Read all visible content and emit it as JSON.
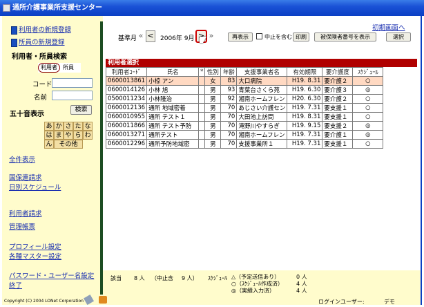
{
  "window": {
    "title": "通所介護事業所支援センター"
  },
  "top_link": "初期画面へ",
  "sidebar": {
    "new_user_reg": "利用者の新規登録",
    "new_staff_reg": "所員の新規登録",
    "search_heading": "利用者・所員検索",
    "radio_user": "利用者",
    "radio_staff": "所員",
    "code_label": "コード",
    "name_label": "名前",
    "gojuon_label": "五十音表示",
    "search_button": "検索",
    "kana_row1": [
      "あ",
      "か",
      "さ",
      "た",
      "な"
    ],
    "kana_row2": [
      "は",
      "ま",
      "や",
      "ら",
      "わ"
    ],
    "kana_row3_first": "ん",
    "kana_other": "その他",
    "links": [
      "全件表示",
      "国保連請求",
      "日別スケジュール",
      "利用者請求",
      "管理帳票",
      "プロフィール設定",
      "各種マスター設定",
      "パスワード・ユーザー名設定",
      "終了"
    ]
  },
  "toolbar": {
    "month_label": "基準月",
    "prev_prev": "«",
    "prev": "<",
    "month_value": "2006年 9月",
    "next": ">",
    "next_next": "»",
    "display_btn": "再表示",
    "include_suspended": "中止を含む",
    "print_btn": "印刷",
    "insured_no_btn": "被保険者番号を表示",
    "select_btn": "選択"
  },
  "section_title": "利用者選択",
  "table": {
    "headers": [
      "利用者ｺｰﾄﾞ",
      "氏名",
      "*",
      "性別",
      "年齢",
      "支援事業者名",
      "有効期限",
      "要介護度",
      "ｽｹｼﾞｭｰﾙ"
    ],
    "rows": [
      [
        "0600013861",
        "小椋 アン",
        "",
        "女",
        "83",
        "大口病院",
        "H19. 8.31",
        "要介護２",
        "○"
      ],
      [
        "0600014126",
        "小林 旭",
        "",
        "男",
        "93",
        "青葉台さくら苑",
        "H19. 6.30",
        "要介護３",
        "◎"
      ],
      [
        "0500011234",
        "小林隆治",
        "",
        "男",
        "92",
        "湘南ホームフレン",
        "H20. 6.30",
        "要介護２",
        "○"
      ],
      [
        "0600012136",
        "通所 地域密着",
        "",
        "男",
        "70",
        "あじさい介護セン",
        "H19. 7.31",
        "要支援１",
        "○"
      ],
      [
        "0600010955",
        "通所 テスト１",
        "",
        "男",
        "70",
        "大田池上訪問",
        "H19. 8.31",
        "要支援１",
        "○"
      ],
      [
        "0600011866",
        "通所 テスト予防",
        "",
        "男",
        "70",
        "滝野川やすらぎ",
        "H19. 9.15",
        "要支援２",
        "◎"
      ],
      [
        "0600013271",
        "通所テスト",
        "",
        "男",
        "70",
        "湘南ホームフレン",
        "H19. 7.31",
        "要介護１",
        "◎"
      ],
      [
        "0600012296",
        "通所予防地域密",
        "",
        "男",
        "70",
        "支援事業所１",
        "H19. 7.31",
        "要支援１",
        "○"
      ]
    ]
  },
  "status": {
    "count_label": "該当",
    "count_value": "8 人",
    "suspended_label": "（中止含",
    "suspended_value": "9 人）",
    "schedule_label": "ｽｹｼﾞｭｰﾙ",
    "legend": [
      {
        "symbol_text": "△（予定送信あり）",
        "value": "0 人"
      },
      {
        "symbol_text": "○（ｽｹｼﾞｭｰﾙ作成済）",
        "value": "4 人"
      },
      {
        "symbol_text": "◎（実績入力済）",
        "value": "4 人"
      }
    ]
  },
  "footer": {
    "copyright": "Copyright (C) 2004 LONet Corporation",
    "login_label": "ログインユーザー:",
    "login_user": "デモ"
  }
}
